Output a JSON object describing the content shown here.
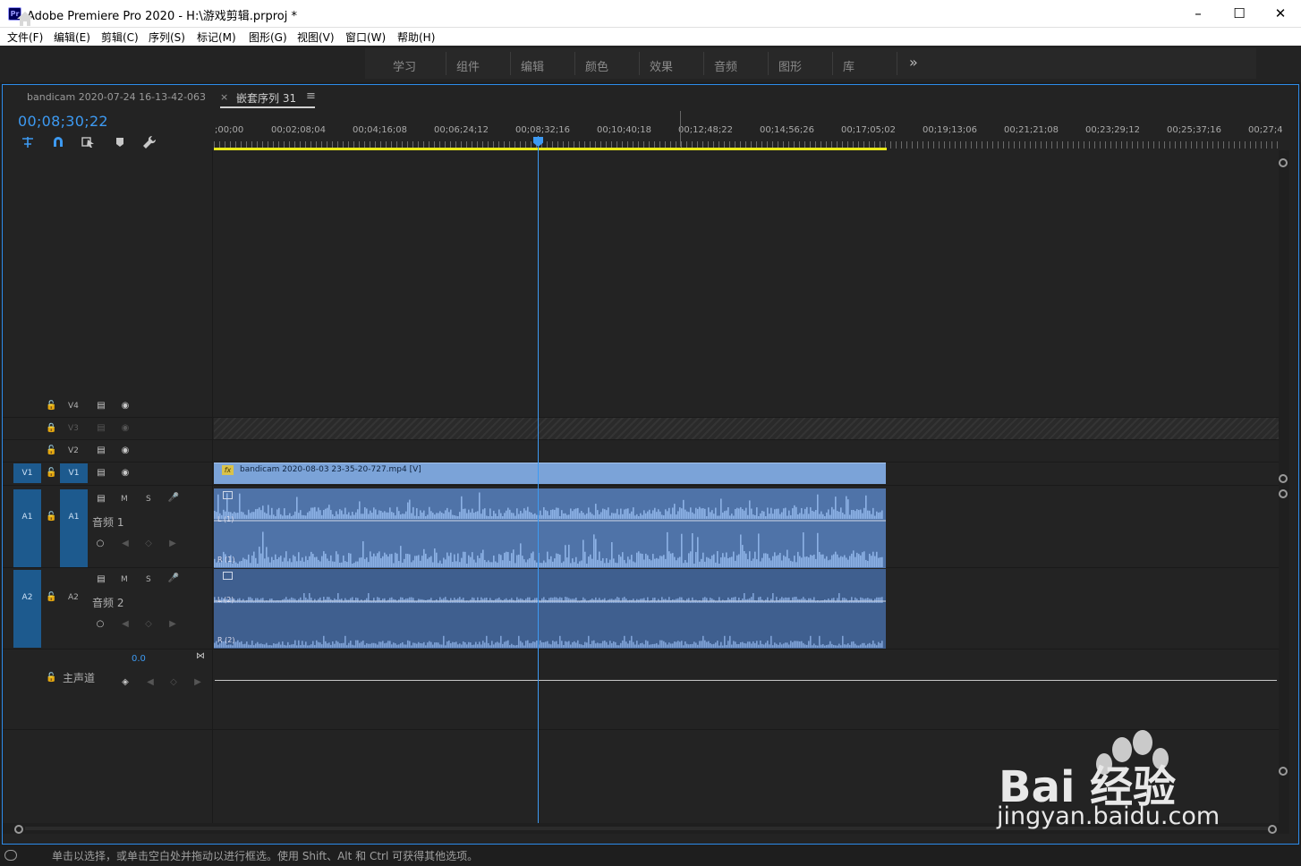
{
  "window": {
    "title": "Adobe Premiere Pro 2020 - H:\\游戏剪辑.prproj *",
    "app_icon": "Pr",
    "controls": [
      "minimize-icon",
      "maximize-icon",
      "close-icon"
    ]
  },
  "menu": [
    "文件(F)",
    "编辑(E)",
    "剪辑(C)",
    "序列(S)",
    "标记(M)",
    "图形(G)",
    "视图(V)",
    "窗口(W)",
    "帮助(H)"
  ],
  "workspaces": [
    "学习",
    "组件",
    "编辑",
    "颜色",
    "效果",
    "音频",
    "图形",
    "库"
  ],
  "workspace_more": "»",
  "timeline": {
    "tab_clip": "bandicam 2020-07-24 16-13-42-063",
    "tab_close": "×",
    "tab_active": "嵌套序列 31",
    "tab_menu": "≡",
    "timecode": "00;08;30;22",
    "ruler_labels": [
      ";00;00",
      "00;02;08;04",
      "00;04;16;08",
      "00;06;24;12",
      "00;08;32;16",
      "00;10;40;18",
      "00;12;48;22",
      "00;14;56;26",
      "00;17;05;02",
      "00;19;13;06",
      "00;21;21;08",
      "00;23;29;12",
      "00;25;37;16",
      "00;27;4"
    ],
    "tracks": {
      "v4": "V4",
      "v3": "V3",
      "v2": "V2",
      "v1": "V1",
      "v1_source": "V1",
      "a1": "A1",
      "a1_source": "A1",
      "a1_name": "音频 1",
      "a2": "A2",
      "a2_source": "A2",
      "a2_name": "音频 2",
      "m": "M",
      "s": "S"
    },
    "video_clip": "bandicam 2020-08-03 23-35-20-727.mp4 [V]",
    "fx": "fx",
    "audio_channels": [
      "L (1)",
      "R (1)",
      "L (2)",
      "R (2)"
    ],
    "master_value": "0.0",
    "master_label": "主声道"
  },
  "status_text": "单击以选择，或单击空白处并拖动以进行框选。使用 Shift、Alt 和 Ctrl 可获得其他选项。",
  "watermark": {
    "brand": "Bai  经验",
    "url": "jingyan.baidu.com"
  },
  "colors": {
    "accent": "#3d9af2",
    "clip_video": "#7ba3d8",
    "clip_audio": "#4f73a8",
    "work_area": "#e8e81a"
  }
}
